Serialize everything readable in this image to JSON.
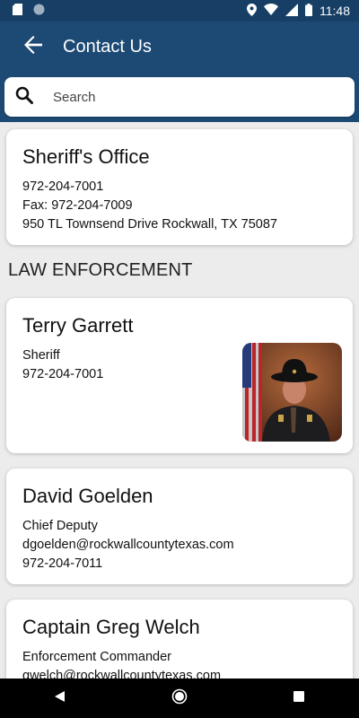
{
  "status_bar": {
    "time": "11:48"
  },
  "app_bar": {
    "title": "Contact Us"
  },
  "search": {
    "placeholder": "Search"
  },
  "main_card": {
    "name": "Sheriff's Office",
    "phone": "972-204-7001",
    "fax": "Fax: 972-204-7009",
    "address": "950 TL Townsend Drive Rockwall, TX 75087"
  },
  "section": {
    "title": "LAW ENFORCEMENT"
  },
  "contacts": [
    {
      "name": "Terry Garrett",
      "title": "Sheriff",
      "phone": "972-204-7001"
    },
    {
      "name": "David Goelden",
      "title": "Chief Deputy",
      "email": "dgoelden@rockwallcountytexas.com",
      "phone": "972-204-7011"
    },
    {
      "name": "Captain Greg Welch",
      "title": "Enforcement Commander",
      "email": "gwelch@rockwallcountytexas.com"
    }
  ],
  "icons": {
    "back": "arrow-left-icon",
    "search": "search-icon",
    "nav_back": "triangle-back-icon",
    "nav_home": "circle-home-icon",
    "nav_recents": "square-recents-icon"
  },
  "colors": {
    "app_bar": "#1d4a74",
    "status_bar": "#173f66",
    "background": "#ececec"
  }
}
